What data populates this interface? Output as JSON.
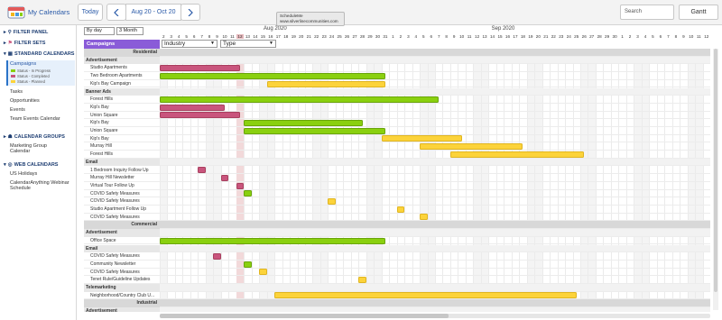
{
  "app": {
    "title": "My Calendars",
    "today_label": "Today",
    "prev_icon": "chevron-left-icon",
    "next_icon": "chevron-right-icon",
    "date_range": "Aug 20 - Oct 20",
    "tooltip_line1": "ScheduleMe",
    "tooltip_line2": "www.silverlinecommunities.com",
    "search_placeholder": "Search",
    "view_label": "Gantt"
  },
  "sidebar": {
    "filter_panel": "FILTER PANEL",
    "filter_sets": "FILTER SETS",
    "standard_calendars": "STANDARD CALENDARS",
    "campaigns": "Campaigns",
    "legend": [
      {
        "label": "Status - In Progress",
        "color": "#8ad00f"
      },
      {
        "label": "Status - Completed",
        "color": "#c9557d"
      },
      {
        "label": "Status - Planned",
        "color": "#fcd33a"
      }
    ],
    "standard_items": [
      "Tasks",
      "Opportunities",
      "Events",
      "Team Events Calendar"
    ],
    "calendar_groups": "CALENDAR GROUPS",
    "group_items": [
      "Marketing Group Calendar"
    ],
    "web_calendars": "WEB CALENDARS",
    "web_items": [
      "US Holidays",
      "CalendarAnything Webinar Schedule"
    ]
  },
  "grid": {
    "scale_select": "By day",
    "span_select": "3 Month",
    "rows_header": "Campaigns",
    "filter1": "Industry",
    "filter2": "Type",
    "months": [
      {
        "label": "Aug 2020",
        "start_index": 0
      },
      {
        "label": "Sep 2020",
        "start_index": 31
      }
    ],
    "days": [
      "2",
      "3",
      "4",
      "5",
      "6",
      "7",
      "8",
      "9",
      "10",
      "11",
      "12",
      "13",
      "14",
      "15",
      "16",
      "17",
      "18",
      "19",
      "20",
      "21",
      "22",
      "23",
      "24",
      "25",
      "26",
      "27",
      "28",
      "29",
      "30",
      "31",
      "1",
      "2",
      "3",
      "4",
      "5",
      "6",
      "7",
      "8",
      "9",
      "10",
      "11",
      "12",
      "13",
      "14",
      "15",
      "16",
      "17",
      "18",
      "19",
      "20",
      "21",
      "22",
      "23",
      "24",
      "25",
      "26",
      "27",
      "28",
      "29",
      "30",
      "1",
      "2",
      "3",
      "4",
      "5",
      "6",
      "7",
      "8",
      "9",
      "10",
      "11",
      "12"
    ],
    "today_index": 10,
    "rows": [
      {
        "type": "cat",
        "label": "Residential"
      },
      {
        "type": "grp",
        "label": "Advertisement"
      },
      {
        "type": "item",
        "label": "Studio Apartments",
        "bar": {
          "start": 0,
          "end": 10.5,
          "status": "pink"
        }
      },
      {
        "type": "item",
        "label": "Two Bedroom Apartments",
        "bar": {
          "start": 0,
          "end": 29.5,
          "status": "green"
        }
      },
      {
        "type": "item",
        "label": "Kip's Bay Campaign",
        "bar": {
          "start": 14,
          "end": 29.5,
          "status": "yellow"
        }
      },
      {
        "type": "grp",
        "label": "Banner Ads"
      },
      {
        "type": "item",
        "label": "Forest Hills",
        "bar": {
          "start": 0,
          "end": 36.5,
          "status": "green"
        }
      },
      {
        "type": "item",
        "label": "Kip's Bay",
        "bar": {
          "start": 0,
          "end": 8.5,
          "status": "pink"
        }
      },
      {
        "type": "item",
        "label": "Union Square",
        "bar": {
          "start": 0,
          "end": 10.5,
          "status": "pink"
        }
      },
      {
        "type": "item",
        "label": "Kip's Bay",
        "bar": {
          "start": 11,
          "end": 26.5,
          "status": "green"
        }
      },
      {
        "type": "item",
        "label": "Union Square",
        "bar": {
          "start": 11,
          "end": 29.5,
          "status": "green"
        }
      },
      {
        "type": "item",
        "label": "Kip's Bay",
        "bar": {
          "start": 29,
          "end": 39.5,
          "status": "yellow"
        }
      },
      {
        "type": "item",
        "label": "Murray Hill",
        "bar": {
          "start": 34,
          "end": 47.5,
          "status": "yellow"
        }
      },
      {
        "type": "item",
        "label": "Forest Hills",
        "bar": {
          "start": 38,
          "end": 55.5,
          "status": "yellow"
        }
      },
      {
        "type": "grp",
        "label": "Email"
      },
      {
        "type": "item",
        "label": "1 Bedroom Inquiry Follow Up",
        "bar": {
          "start": 5,
          "end": 6,
          "status": "pink"
        }
      },
      {
        "type": "item",
        "label": "Murray Hill Newsletter",
        "bar": {
          "start": 8,
          "end": 9,
          "status": "pink"
        }
      },
      {
        "type": "item",
        "label": "Virtual Tour Follow Up",
        "bar": {
          "start": 10,
          "end": 11,
          "status": "pink"
        }
      },
      {
        "type": "item",
        "label": "COVID Safety Measures",
        "bar": {
          "start": 11,
          "end": 12,
          "status": "green"
        }
      },
      {
        "type": "item",
        "label": "COVID Safety Measures",
        "bar": {
          "start": 22,
          "end": 23,
          "status": "yellow"
        }
      },
      {
        "type": "item",
        "label": "Studio Apartment Follow Up",
        "bar": {
          "start": 31,
          "end": 32,
          "status": "yellow"
        }
      },
      {
        "type": "item",
        "label": "COVID Safety Measures",
        "bar": {
          "start": 34,
          "end": 35,
          "status": "yellow"
        }
      },
      {
        "type": "cat",
        "label": "Commercial"
      },
      {
        "type": "grp",
        "label": "Advertisement"
      },
      {
        "type": "item",
        "label": "Office Space",
        "bar": {
          "start": 0,
          "end": 29.5,
          "status": "green"
        }
      },
      {
        "type": "grp",
        "label": "Email"
      },
      {
        "type": "item",
        "label": "COVID Safety Measures",
        "bar": {
          "start": 7,
          "end": 8,
          "status": "pink"
        }
      },
      {
        "type": "item",
        "label": "Community Newsletter",
        "bar": {
          "start": 11,
          "end": 12,
          "status": "green"
        }
      },
      {
        "type": "item",
        "label": "COVID Safety Measures",
        "bar": {
          "start": 13,
          "end": 14,
          "status": "yellow"
        }
      },
      {
        "type": "item",
        "label": "Tenet Rule/Guideline Updates",
        "bar": {
          "start": 26,
          "end": 27,
          "status": "yellow"
        }
      },
      {
        "type": "grp",
        "label": "Telemarketing"
      },
      {
        "type": "item",
        "label": "Neighborhood/Country Club U...",
        "bar": {
          "start": 15,
          "end": 54.5,
          "status": "yellow"
        }
      },
      {
        "type": "cat",
        "label": "Industrial"
      },
      {
        "type": "grp",
        "label": "Advertisement"
      }
    ]
  }
}
